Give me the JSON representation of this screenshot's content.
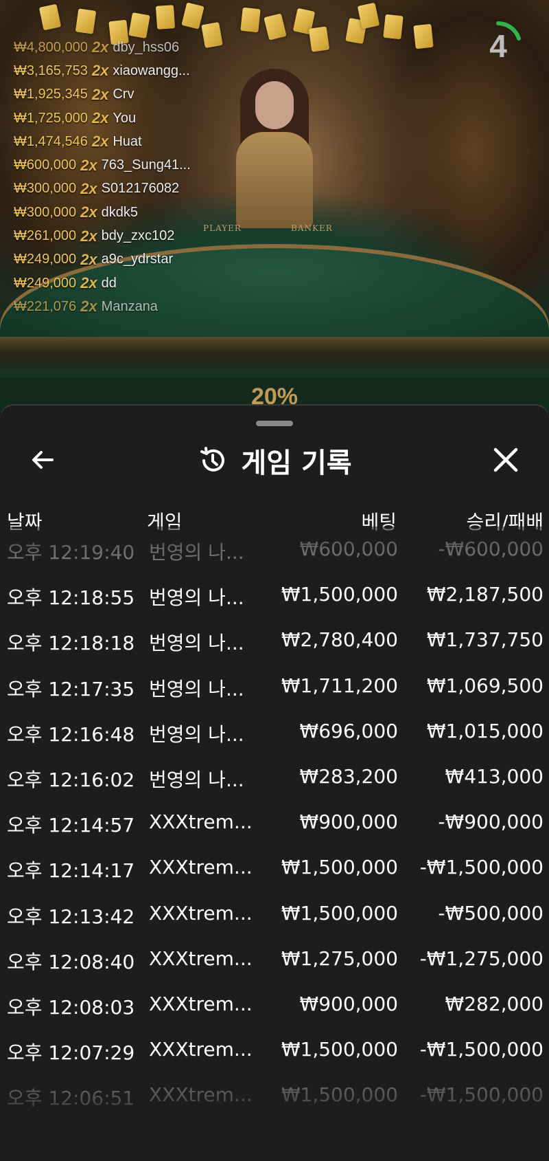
{
  "game_view": {
    "countdown": "4",
    "table_labels": {
      "player": "PLAYER",
      "banker": "BANKER"
    },
    "progress_text": "20%",
    "big_wins": [
      {
        "amount": "₩4,800,000",
        "multiplier": "2x",
        "user": "dby_hss06"
      },
      {
        "amount": "₩3,165,753",
        "multiplier": "2x",
        "user": "xiaowangg..."
      },
      {
        "amount": "₩1,925,345",
        "multiplier": "2x",
        "user": "Crv"
      },
      {
        "amount": "₩1,725,000",
        "multiplier": "2x",
        "user": "You"
      },
      {
        "amount": "₩1,474,546",
        "multiplier": "2x",
        "user": "Huat"
      },
      {
        "amount": "₩600,000",
        "multiplier": "2x",
        "user": "763_Sung41..."
      },
      {
        "amount": "₩300,000",
        "multiplier": "2x",
        "user": "S012176082"
      },
      {
        "amount": "₩300,000",
        "multiplier": "2x",
        "user": "dkdk5"
      },
      {
        "amount": "₩261,000",
        "multiplier": "2x",
        "user": "bdy_zxc102"
      },
      {
        "amount": "₩249,000",
        "multiplier": "2x",
        "user": "a9c_ydrstar"
      },
      {
        "amount": "₩249,000",
        "multiplier": "2x",
        "user": "dd"
      },
      {
        "amount": "₩221,076",
        "multiplier": "2x",
        "user": "Manzana"
      }
    ]
  },
  "history": {
    "title": "게임 기록",
    "back_icon": "arrow-left-icon",
    "title_icon": "history-icon",
    "close_icon": "close-icon",
    "columns": {
      "date": "날짜",
      "game": "게임",
      "bet": "베팅",
      "result": "승리/패배"
    },
    "rows": [
      {
        "date": "오후 12:19:40",
        "game": "번영의 나...",
        "bet": "₩600,000",
        "result": "-₩600,000"
      },
      {
        "date": "오후 12:18:55",
        "game": "번영의 나...",
        "bet": "₩1,500,000",
        "result": "₩2,187,500"
      },
      {
        "date": "오후 12:18:18",
        "game": "번영의 나...",
        "bet": "₩2,780,400",
        "result": "₩1,737,750"
      },
      {
        "date": "오후 12:17:35",
        "game": "번영의 나...",
        "bet": "₩1,711,200",
        "result": "₩1,069,500"
      },
      {
        "date": "오후 12:16:48",
        "game": "번영의 나...",
        "bet": "₩696,000",
        "result": "₩1,015,000"
      },
      {
        "date": "오후 12:16:02",
        "game": "번영의 나...",
        "bet": "₩283,200",
        "result": "₩413,000"
      },
      {
        "date": "오후 12:14:57",
        "game": "XXXtrem...",
        "bet": "₩900,000",
        "result": "-₩900,000"
      },
      {
        "date": "오후 12:14:17",
        "game": "XXXtrem...",
        "bet": "₩1,500,000",
        "result": "-₩1,500,000"
      },
      {
        "date": "오후 12:13:42",
        "game": "XXXtrem...",
        "bet": "₩1,500,000",
        "result": "-₩500,000"
      },
      {
        "date": "오후 12:08:40",
        "game": "XXXtrem...",
        "bet": "₩1,275,000",
        "result": "-₩1,275,000"
      },
      {
        "date": "오후 12:08:03",
        "game": "XXXtrem...",
        "bet": "₩900,000",
        "result": "₩282,000"
      },
      {
        "date": "오후 12:07:29",
        "game": "XXXtrem...",
        "bet": "₩1,500,000",
        "result": "-₩1,500,000"
      },
      {
        "date": "오후 12:06:51",
        "game": "XXXtrem...",
        "bet": "₩1,500,000",
        "result": "-₩1,500,000"
      }
    ]
  },
  "colors": {
    "sheet_bg": "#1d1d1d",
    "gold": "#f0c657",
    "text": "#ffffff"
  }
}
